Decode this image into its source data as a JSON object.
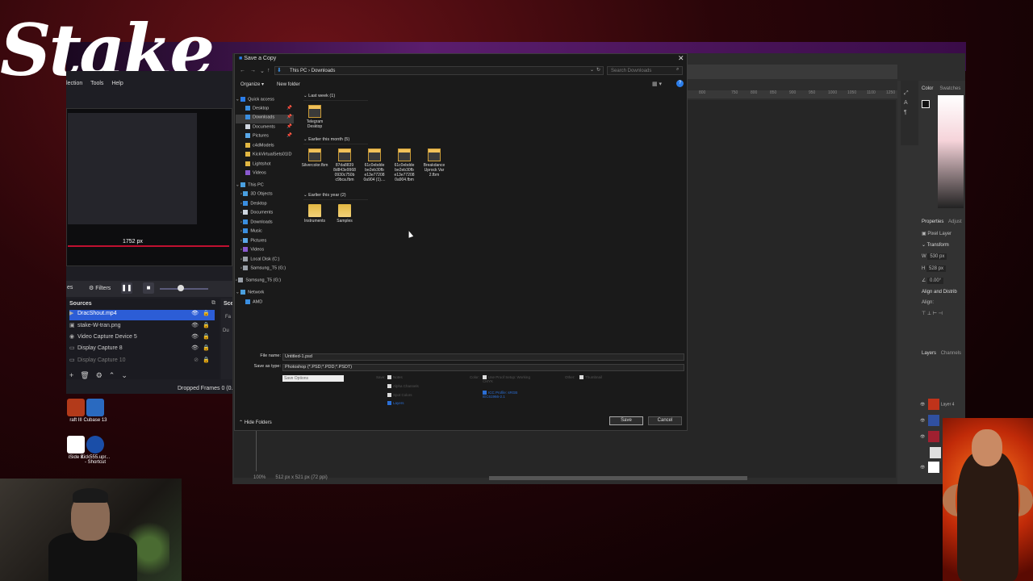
{
  "stake": {
    "logo": "Stake"
  },
  "obs": {
    "menu": [
      "lection",
      "Tools",
      "Help"
    ],
    "preview_size": "1752 px",
    "filters_label": "Filters",
    "filters_prefix": "es",
    "sources_header": "Sources",
    "scenes_header": "Sce",
    "sources": [
      {
        "label": "DracShout.mp4",
        "selected": true
      },
      {
        "label": "stake-W-tran.png",
        "selected": false
      },
      {
        "label": "Video Capture Device 5",
        "selected": false
      },
      {
        "label": "Display Capture 8",
        "selected": false
      },
      {
        "label": "Display Capture 10",
        "selected": false
      }
    ],
    "side_labels": [
      "Fa",
      "Du"
    ],
    "dropped_frames": "Dropped Frames 0 (0.0"
  },
  "desktop": {
    "icons": [
      {
        "label": "raft III",
        "color": "#b33a1a"
      },
      {
        "label": "Cubase 13",
        "color": "#2a6ac0"
      },
      {
        "label": "iSide 2",
        "color": "#ffffff"
      },
      {
        "label": "Kick555.upr... - Shortcut",
        "color": "#1a4ea8"
      }
    ]
  },
  "photoshop": {
    "ruler_ticks": [
      "800",
      "850",
      "700",
      "750",
      "800",
      "850",
      "900",
      "950",
      "1000",
      "1050",
      "1100",
      "1150",
      "1200",
      "1250"
    ],
    "color_tabs": [
      "Color",
      "Swatches"
    ],
    "properties_tabs": [
      "Properties",
      "Adjust"
    ],
    "pixel_layer": "Pixel Layer",
    "transform": "Transform",
    "w_value": "530 px",
    "h_value": "528 px",
    "angle_value": "0.00°",
    "align_header": "Align and Distrib",
    "align_label": "Align:",
    "layers_tabs": [
      "Layers",
      "Channels"
    ],
    "layers": [
      "Layer 4",
      "",
      "",
      "",
      ""
    ],
    "layer_thumb_colors": [
      "#c0331a",
      "#3050a0",
      "#a02030",
      "#e0e0e0",
      "#ffffff"
    ],
    "status_zoom": "100%",
    "status_doc": "512 px x 521 px (72 ppi)"
  },
  "dialog": {
    "title": "Save a Copy",
    "path": [
      "This PC",
      "Downloads"
    ],
    "search_placeholder": "Search Downloads",
    "organize": "Organize ▾",
    "new_folder": "New folder",
    "tree": [
      {
        "label": "Quick access",
        "level": 0,
        "color": "#2b7de9",
        "selected": false,
        "pin": false
      },
      {
        "label": "Desktop",
        "level": 1,
        "color": "#3a8ee0",
        "selected": false,
        "pin": true
      },
      {
        "label": "Downloads",
        "level": 1,
        "color": "#3a8ee0",
        "selected": true,
        "pin": true
      },
      {
        "label": "Documents",
        "level": 1,
        "color": "#cfd6e0",
        "selected": false,
        "pin": true
      },
      {
        "label": "Pictures",
        "level": 1,
        "color": "#5aa8e8",
        "selected": false,
        "pin": true
      },
      {
        "label": "c4dModels",
        "level": 1,
        "color": "#e2b742",
        "selected": false,
        "pin": false
      },
      {
        "label": "KickVirtualSets01ID",
        "level": 1,
        "color": "#e2b742",
        "selected": false,
        "pin": false
      },
      {
        "label": "Lightshot",
        "level": 1,
        "color": "#e2b742",
        "selected": false,
        "pin": false
      },
      {
        "label": "Videos",
        "level": 1,
        "color": "#8a5ad0",
        "selected": false,
        "pin": false
      },
      {
        "label": "This PC",
        "level": 0,
        "color": "#4aa0e0",
        "selected": false,
        "pin": false
      },
      {
        "label": "3D Objects",
        "level": 1,
        "color": "#4aa0e0",
        "selected": false,
        "pin": false
      },
      {
        "label": "Desktop",
        "level": 1,
        "color": "#3a8ee0",
        "selected": false,
        "pin": false
      },
      {
        "label": "Documents",
        "level": 1,
        "color": "#cfd6e0",
        "selected": false,
        "pin": false
      },
      {
        "label": "Downloads",
        "level": 1,
        "color": "#3a8ee0",
        "selected": false,
        "pin": false
      },
      {
        "label": "Music",
        "level": 1,
        "color": "#3a8ee0",
        "selected": false,
        "pin": false
      },
      {
        "label": "Pictures",
        "level": 1,
        "color": "#5aa8e8",
        "selected": false,
        "pin": false
      },
      {
        "label": "Videos",
        "level": 1,
        "color": "#8a5ad0",
        "selected": false,
        "pin": false
      },
      {
        "label": "Local Disk (C:)",
        "level": 1,
        "color": "#9aa0a8",
        "selected": false,
        "pin": false
      },
      {
        "label": "Samsung_T5 (G:)",
        "level": 1,
        "color": "#9aa0a8",
        "selected": false,
        "pin": false
      },
      {
        "label": "Samsung_T5 (G:)",
        "level": 0,
        "color": "#9aa0a8",
        "selected": false,
        "pin": false
      },
      {
        "label": "Network",
        "level": 0,
        "color": "#4aa0e0",
        "selected": false,
        "pin": false
      },
      {
        "label": "AMD",
        "level": 1,
        "color": "#3a8ee0",
        "selected": false,
        "pin": false
      }
    ],
    "groups": [
      {
        "label": "Last week (1)"
      },
      {
        "label": "Earlier this month (5)"
      },
      {
        "label": "Earlier this year (2)"
      }
    ],
    "files_last_week": [
      {
        "name": "Telegram Desktop",
        "kind": "doc"
      }
    ],
    "files_this_month": [
      {
        "name": "Silvercolor.fbm",
        "kind": "doc"
      },
      {
        "name": "87da8839 8d843e9968 0930c750b c9bca.fbm",
        "kind": "doc"
      },
      {
        "name": "61c0ebdde be2eb30fb e13e77208 0a904 (1)....",
        "kind": "doc"
      },
      {
        "name": "61c0ebdde be2eb30fb e13e77208 0a904.fbm",
        "kind": "doc"
      },
      {
        "name": "Breakdance Uprock Var 2.fbm",
        "kind": "doc"
      }
    ],
    "files_this_year": [
      {
        "name": "Instruments",
        "kind": "folder"
      },
      {
        "name": "Samples",
        "kind": "folder"
      }
    ],
    "file_name_label": "File name:",
    "file_name_value": "Untitled-1.psd",
    "save_type_label": "Save as type:",
    "save_type_value": "Photoshop (*.PSD;*.PDD;*.PSDT)",
    "save_options": "Save Options",
    "opt_save_label": "Save:",
    "opt_notes": "Notes",
    "opt_alpha": "Alpha Channels",
    "opt_spot": "Spot Colors",
    "opt_layers": "Layers",
    "opt_color_label": "Color:",
    "opt_proof": "Use Proof Setup: Working CMYK",
    "opt_icc": "ICC Profile: sRGB IEC61966-2.1",
    "opt_other_label": "Other:",
    "opt_thumbnail": "Thumbnail",
    "hide_folders": "Hide Folders",
    "save_button": "Save",
    "cancel_button": "Cancel"
  }
}
